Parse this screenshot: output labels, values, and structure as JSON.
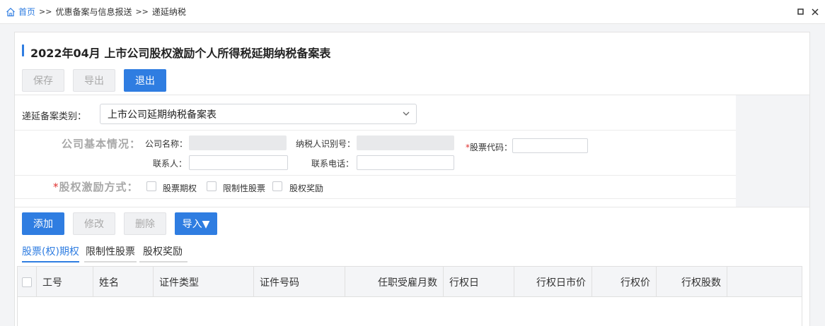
{
  "breadcrumb": {
    "home": "首页",
    "sep": ">>",
    "level2": "优惠备案与信息报送",
    "level3": "递延纳税"
  },
  "title": "2022年04月  上市公司股权激励个人所得税延期纳税备案表",
  "toolbar": {
    "save": "保存",
    "export": "导出",
    "exit": "退出"
  },
  "form": {
    "category_label": "递延备案类别：",
    "category_value": "上市公司延期纳税备案表",
    "company_section": "公司基本情况：",
    "company_name_label": "公司名称：",
    "tax_id_label": "纳税人识别号：",
    "stock_code_req": "*",
    "stock_code_label": "股票代码：",
    "contact_label": "联系人：",
    "phone_label": "联系电话：",
    "incentive_req": "*",
    "incentive_label": "股权激励方式：",
    "incentive_options": [
      "股票期权",
      "限制性股票",
      "股权奖励"
    ]
  },
  "actions": {
    "add": "添加",
    "edit": "修改",
    "delete": "删除",
    "import": "导入▼"
  },
  "tabs": [
    "股票(权)期权",
    "限制性股票",
    "股权奖励"
  ],
  "table": {
    "columns": [
      "工号",
      "姓名",
      "证件类型",
      "证件号码",
      "任职受雇月数",
      "行权日",
      "行权日市价",
      "行权价",
      "行权股数"
    ]
  },
  "colors": {
    "accent": "#2f7de1",
    "required": "#e0312f"
  }
}
